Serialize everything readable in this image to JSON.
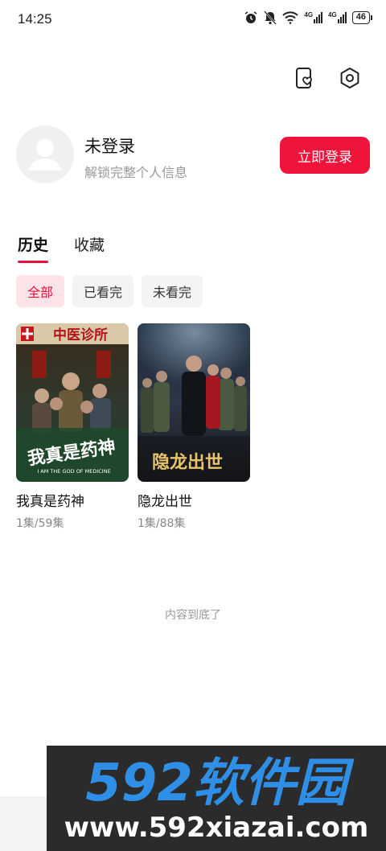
{
  "status_bar": {
    "time": "14:25",
    "network_1": "4G",
    "network_2": "4G",
    "battery": "46",
    "icons": [
      "alarm-icon",
      "mute-icon",
      "wifi-icon",
      "signal-icon",
      "signal-icon",
      "battery-icon"
    ]
  },
  "top_actions": {
    "icons": [
      "favorite-phone-icon",
      "settings-hexagon-icon"
    ]
  },
  "profile": {
    "title": "未登录",
    "subtitle": "解锁完整个人信息",
    "login_button": "立即登录",
    "accent": "#f0133a"
  },
  "tabs": [
    {
      "label": "历史",
      "active": true
    },
    {
      "label": "收藏",
      "active": false
    }
  ],
  "filters": [
    {
      "label": "全部",
      "active": true
    },
    {
      "label": "已看完",
      "active": false
    },
    {
      "label": "未看完",
      "active": false
    }
  ],
  "history_items": [
    {
      "title": "我真是药神",
      "progress": "1集/59集",
      "poster_sign": "中医诊所",
      "poster_title": "我真是药神",
      "poster_subtitle": "I AM THE GOD OF MEDICINE"
    },
    {
      "title": "隐龙出世",
      "progress": "1集/88集",
      "poster_title": "隐龙出世"
    }
  ],
  "end_text": "内容到底了",
  "watermark": {
    "logo_text": "592软件园",
    "url": "www.592xiazai.com"
  }
}
